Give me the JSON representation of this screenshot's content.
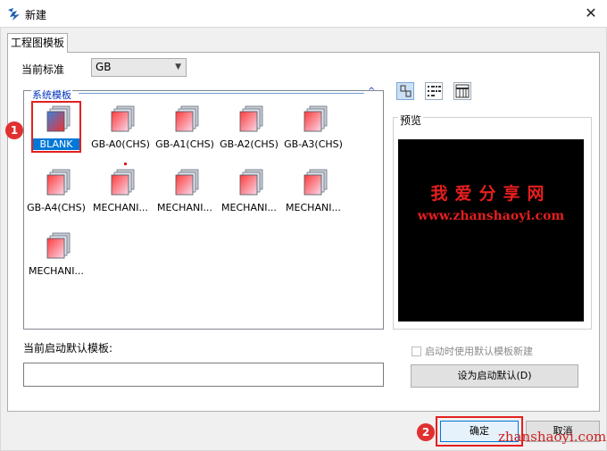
{
  "window": {
    "title": "新建",
    "close_glyph": "✕"
  },
  "tab": {
    "label": "工程图模板"
  },
  "standard": {
    "label": "当前标准",
    "value": "GB"
  },
  "templates": {
    "group_label": "系统模板",
    "collapse_glyph": "^",
    "items": [
      {
        "label": "BLANK",
        "selected": true
      },
      {
        "label": "GB-A0(CHS)"
      },
      {
        "label": "GB-A1(CHS)"
      },
      {
        "label": "GB-A2(CHS)"
      },
      {
        "label": "GB-A3(CHS)"
      },
      {
        "label": "GB-A4(CHS)"
      },
      {
        "label": "MECHANI..."
      },
      {
        "label": "MECHANI..."
      },
      {
        "label": "MECHANI..."
      },
      {
        "label": "MECHANI..."
      },
      {
        "label": "MECHANI..."
      }
    ]
  },
  "preview": {
    "label": "预览",
    "watermark_cn": "我爱分享网",
    "watermark_url": "www.zhanshaoyi.com"
  },
  "default_template": {
    "label": "当前启动默认模板:",
    "value": ""
  },
  "startup": {
    "checkbox_label": "启动时使用默认模板新建",
    "checked": false
  },
  "buttons": {
    "set_default": "设为启动默认(D)",
    "ok": "确定",
    "cancel": "取消"
  },
  "annotations": {
    "step1": "1",
    "step2": "2",
    "bottom_watermark": "zhanshaoyi.com"
  },
  "colors": {
    "selection": "#0078d7",
    "annotation_red": "#e32020",
    "preview_bg": "#000000",
    "watermark": "#e51e1e"
  }
}
